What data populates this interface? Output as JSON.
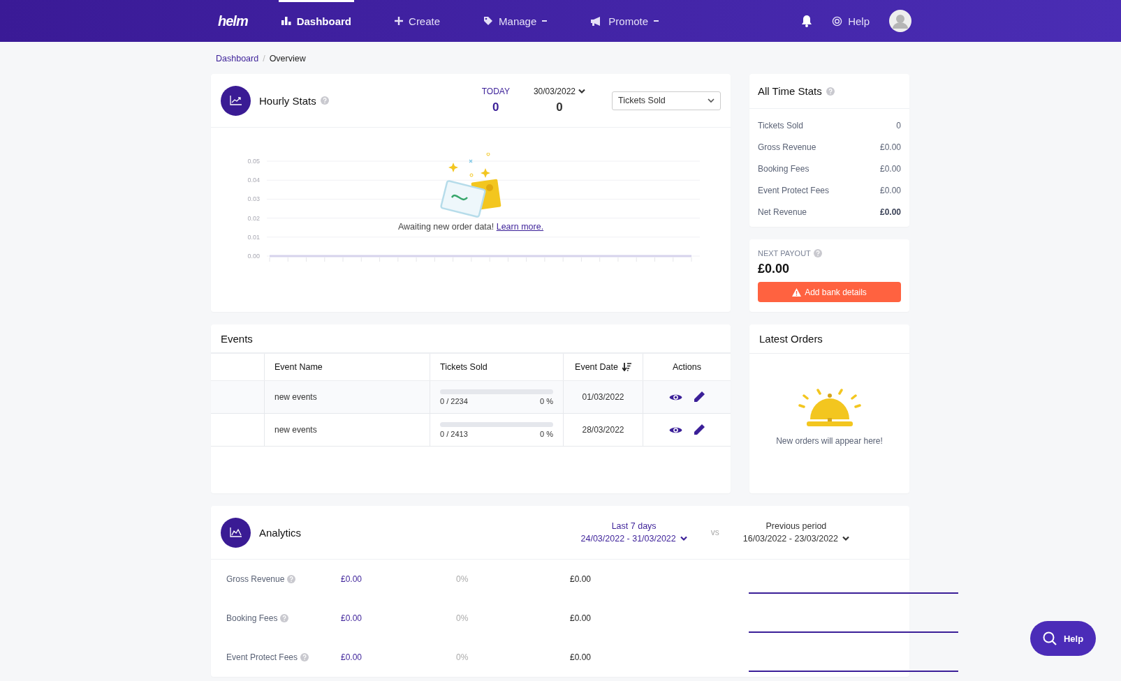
{
  "nav": {
    "logo": "helm",
    "items": [
      {
        "label": "Dashboard",
        "selected": true,
        "dropdown": false
      },
      {
        "label": "Create",
        "selected": false,
        "dropdown": false
      },
      {
        "label": "Manage",
        "selected": false,
        "dropdown": true
      },
      {
        "label": "Promote",
        "selected": false,
        "dropdown": true
      }
    ],
    "help": "Help"
  },
  "breadcrumb": {
    "separator": "/",
    "items": [
      {
        "label": "Dashboard",
        "link": true
      },
      {
        "label": "Overview",
        "link": false
      }
    ]
  },
  "hourly_stats": {
    "title": "Hourly Stats",
    "today_label": "TODAY",
    "today_value": "0",
    "date_label": "30/03/2022",
    "date_value": "0",
    "metric_select": "Tickets Sold",
    "empty_text": "Awaiting new order data!",
    "empty_link": "Learn more.",
    "chart_data": {
      "type": "line",
      "grid": true,
      "ylim": [
        0,
        0.05
      ],
      "yticks": [
        {
          "value": 0,
          "label": "0.00"
        },
        {
          "value": 0.01,
          "label": "0.01"
        },
        {
          "value": 0.02,
          "label": "0.02"
        },
        {
          "value": 0.03,
          "label": "0.03"
        },
        {
          "value": 0.04,
          "label": "0.04"
        },
        {
          "value": 0.05,
          "label": "0.05"
        }
      ],
      "series": [
        {
          "color": "#d6d3ec",
          "values": [
            0,
            0,
            0,
            0,
            0,
            0,
            0,
            0,
            0,
            0,
            0,
            0,
            0,
            0,
            0,
            0,
            0,
            0,
            0,
            0,
            0,
            0,
            0,
            0
          ]
        }
      ]
    }
  },
  "all_time_stats": {
    "title": "All Time Stats",
    "rows": [
      {
        "label": "Tickets Sold",
        "value": "0",
        "bold": false
      },
      {
        "label": "Gross Revenue",
        "value": "£0.00",
        "bold": false
      },
      {
        "label": "Booking Fees",
        "value": "£0.00",
        "bold": false
      },
      {
        "label": "Event Protect Fees",
        "value": "£0.00",
        "bold": false
      },
      {
        "label": "Net Revenue",
        "value": "£0.00",
        "bold": true
      }
    ]
  },
  "next_payout": {
    "label": "NEXT PAYOUT",
    "amount": "£0.00",
    "button": "Add bank details"
  },
  "events": {
    "title": "Events",
    "columns": [
      {
        "label": "Event Name",
        "sortable": false
      },
      {
        "label": "Tickets Sold",
        "sortable": false
      },
      {
        "label": "Event Date",
        "sortable": true
      },
      {
        "label": "Actions",
        "sortable": false
      }
    ],
    "rows": [
      {
        "name": "new events",
        "sold": "0 / 2234",
        "percent": "0 %",
        "level": 0,
        "date": "01/03/2022"
      },
      {
        "name": "new events",
        "sold": "0 / 2413",
        "percent": "0 %",
        "level": 0,
        "date": "28/03/2022"
      }
    ]
  },
  "latest_orders": {
    "title": "Latest Orders",
    "empty_text": "New orders will appear here!"
  },
  "analytics": {
    "title": "Analytics",
    "current_period": {
      "label": "Last 7 days",
      "range": "24/03/2022 - 31/03/2022"
    },
    "vs": "vs",
    "previous_period": {
      "label": "Previous period",
      "range": "16/03/2022 - 23/03/2022"
    },
    "rows": [
      {
        "label": "Gross Revenue",
        "current": "£0.00",
        "change": "0%",
        "previous": "£0.00"
      },
      {
        "label": "Booking Fees",
        "current": "£0.00",
        "change": "0%",
        "previous": "£0.00"
      },
      {
        "label": "Event Protect Fees",
        "current": "£0.00",
        "change": "0%",
        "previous": "£0.00"
      }
    ]
  },
  "help_button": "Help"
}
